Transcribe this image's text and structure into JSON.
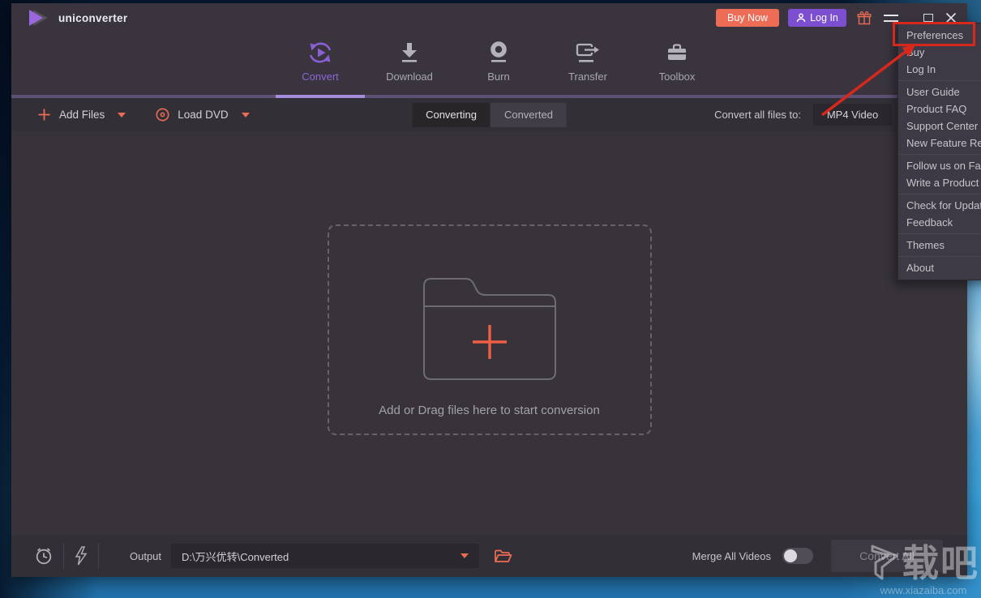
{
  "window": {
    "title": "uniconverter"
  },
  "titlebar": {
    "buy_now": "Buy Now",
    "log_in": "Log In"
  },
  "nav": {
    "tabs": [
      {
        "label": "Convert"
      },
      {
        "label": "Download"
      },
      {
        "label": "Burn"
      },
      {
        "label": "Transfer"
      },
      {
        "label": "Toolbox"
      }
    ]
  },
  "toolbar": {
    "add_files": "Add Files",
    "load_dvd": "Load DVD",
    "tab_converting": "Converting",
    "tab_converted": "Converted",
    "convert_all_label": "Convert all files to:",
    "format_value": "MP4 Video"
  },
  "dropzone": {
    "hint": "Add or Drag files here to start conversion"
  },
  "bottombar": {
    "output_label": "Output",
    "output_path": "D:\\万兴优转\\Converted",
    "merge_label": "Merge All Videos",
    "convert_all_button": "Convert All"
  },
  "menu": {
    "items": [
      "Preferences",
      "Buy",
      "Log In",
      "User Guide",
      "Product FAQ",
      "Support Center",
      "New Feature Re",
      "Follow us on Fac",
      "Write a Product",
      "Check for Update",
      "Feedback",
      "Themes",
      "About"
    ],
    "highlighted": "Preferences"
  },
  "watermark": {
    "brand": "载吧",
    "site": "www.xiazaiba.com"
  },
  "colors": {
    "accent_purple": "#7c4fd0",
    "accent_coral": "#ed6c56",
    "annotation_red": "#d6281c",
    "header_bg": "#39343e",
    "bar_bg": "#332f37",
    "menu_bg": "#3d3945"
  }
}
